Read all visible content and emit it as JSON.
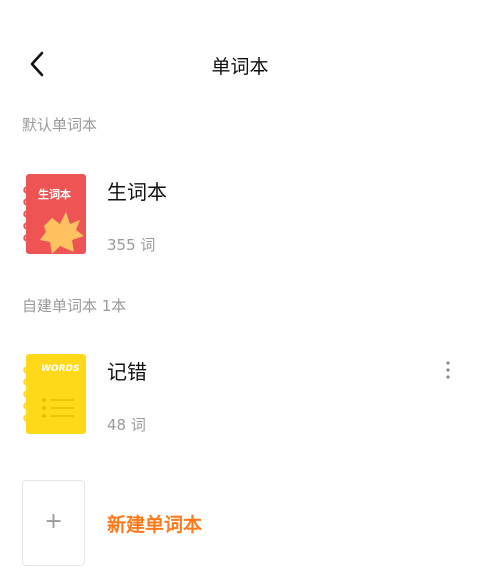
{
  "header": {
    "title": "单词本",
    "back_icon": "chevron-left-icon"
  },
  "sections": {
    "default_label": "默认单词本",
    "custom_label": "自建单词本 1本"
  },
  "books": [
    {
      "name": "生词本",
      "count": "355 词",
      "cover_text": "生词本",
      "cover_color": "#ee5454",
      "accent_color": "#ffc261"
    },
    {
      "name": "记错",
      "count": "48 词",
      "cover_text": "WORDS",
      "cover_color": "#ffd81a",
      "more_icon": "more-vertical-icon"
    }
  ],
  "new_book": {
    "plus": "+",
    "label": "新建单词本",
    "color": "#ff7a1a"
  }
}
